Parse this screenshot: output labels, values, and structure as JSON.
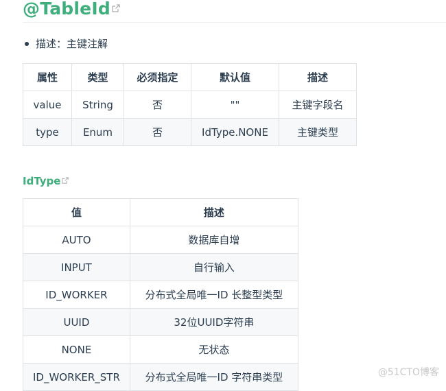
{
  "section": {
    "title": "@TableId",
    "bullet_label": "描述：主键注解"
  },
  "attributes_table": {
    "headers": [
      "属性",
      "类型",
      "必须指定",
      "默认值",
      "描述"
    ],
    "rows": [
      [
        "value",
        "String",
        "否",
        "\"\"",
        "主键字段名"
      ],
      [
        "type",
        "Enum",
        "否",
        "IdType.NONE",
        "主键类型"
      ]
    ]
  },
  "idtype_section": {
    "title": "IdType"
  },
  "idtype_table": {
    "headers": [
      "值",
      "描述"
    ],
    "rows": [
      [
        "AUTO",
        "数据库自增"
      ],
      [
        "INPUT",
        "自行输入"
      ],
      [
        "ID_WORKER",
        "分布式全局唯一ID 长整型类型"
      ],
      [
        "UUID",
        "32位UUID字符串"
      ],
      [
        "NONE",
        "无状态"
      ],
      [
        "ID_WORKER_STR",
        "分布式全局唯一ID 字符串类型"
      ]
    ]
  },
  "watermark": "@51CTO博客",
  "icons": {
    "external_link": "external-link-icon"
  },
  "colors": {
    "accent": "#3eaf7c",
    "text": "#2c3e50",
    "border": "#dfe2e5",
    "row_alt": "#f6f8fa"
  }
}
